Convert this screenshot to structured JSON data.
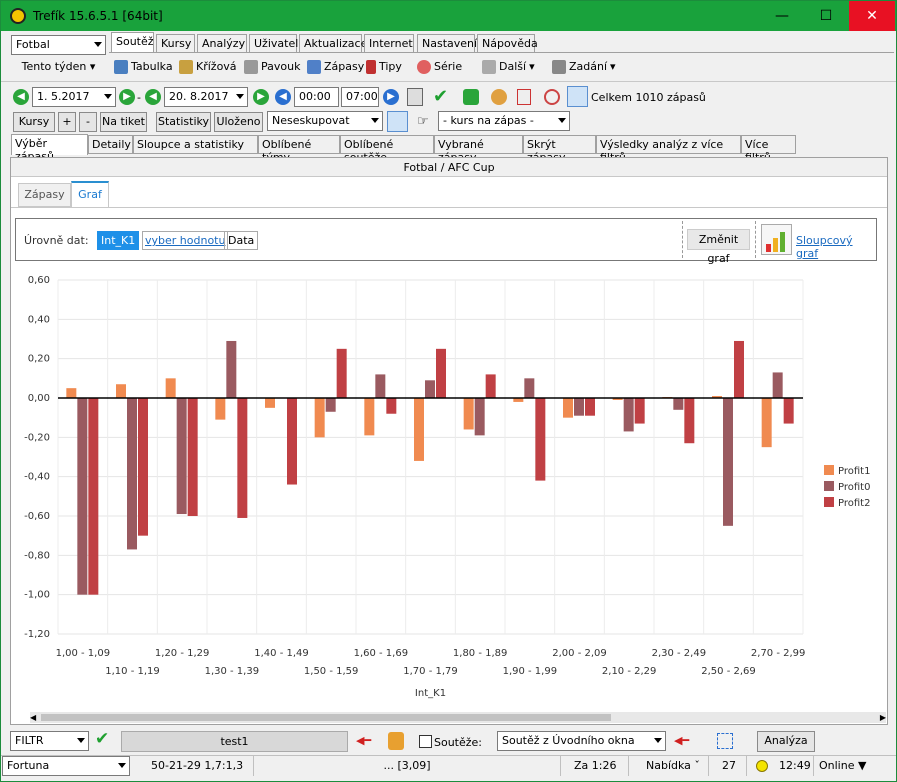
{
  "window": {
    "title": "Trefík 15.6.5.1 [64bit]",
    "min": "—",
    "max": "☐",
    "close": "✕"
  },
  "sport_select": {
    "value": "Fotbal"
  },
  "week_button": {
    "label": "Tento týden"
  },
  "main_tabs": [
    {
      "label": "Soutěž"
    },
    {
      "label": "Kursy"
    },
    {
      "label": "Analýzy"
    },
    {
      "label": "Uživatel"
    },
    {
      "label": "Aktualizace"
    },
    {
      "label": "Internet"
    },
    {
      "label": "Nastavení"
    },
    {
      "label": "Nápověda"
    }
  ],
  "toolbar": {
    "tabulka": "Tabulka",
    "krizova": "Křížová",
    "pavouk": "Pavouk",
    "zapasy": "Zápasy",
    "tipy": "Tipy",
    "serie": "Série",
    "dalsi": "Další",
    "zadani": "Zadání"
  },
  "dates": {
    "from": "1.  5.2017",
    "to": "20.  8.2017",
    "time_from": "00:00",
    "time_to": "07:00",
    "dash": "-"
  },
  "total_matches": "Celkem 1010 zápasů",
  "row3": {
    "kursy": "Kursy",
    "plus": "+",
    "minus": "-",
    "na_tiket": "Na tiket",
    "statistiky": "Statistiky",
    "ulozeno": "Uloženo",
    "group_select": "Neseskupovat",
    "kurs_select": "- kurs na zápas -"
  },
  "sub_tabs": [
    {
      "label": "Výběr zápasů"
    },
    {
      "label": "Detaily"
    },
    {
      "label": "Sloupce a statistiky"
    },
    {
      "label": "Oblíbené týmy"
    },
    {
      "label": "Oblíbené soutěže"
    },
    {
      "label": "Vybrané zápasy"
    },
    {
      "label": "Skrýt zápasy"
    },
    {
      "label": "Výsledky analýz z více filtrů"
    },
    {
      "label": "Více filtrů"
    }
  ],
  "competition_header": "Fotbal / AFC Cup",
  "inner_tabs": [
    {
      "label": "Zápasy"
    },
    {
      "label": "Graf"
    }
  ],
  "levels": {
    "label": "Úrovně dat:",
    "chip1": "Int_K1",
    "chip2": "vyber hodnotu",
    "chip3": "Data",
    "change_graph": "Změnit graf",
    "bar_graph_link": "Sloupcový graf"
  },
  "chart_data": {
    "type": "bar",
    "xlabel": "Int_K1",
    "ylim": [
      -1.2,
      0.6
    ],
    "yticks": [
      "0,60",
      "0,40",
      "0,20",
      "0,00",
      "-0,20",
      "-0,40",
      "-0,60",
      "-0,80",
      "-1,00",
      "-1,20"
    ],
    "categories": [
      "1,00 - 1,09",
      "1,10 - 1,19",
      "1,20 - 1,29",
      "1,30 - 1,39",
      "1,40 - 1,49",
      "1,50 - 1,59",
      "1,60 - 1,69",
      "1,70 - 1,79",
      "1,80 - 1,89",
      "1,90 - 1,99",
      "2,00 - 2,09",
      "2,10 - 2,29",
      "2,30 - 2,49",
      "2,50 - 2,69",
      "2,70 - 2,99"
    ],
    "series": [
      {
        "name": "Profit1",
        "color": "#f08a50",
        "values": [
          0.05,
          0.07,
          0.1,
          -0.11,
          -0.05,
          -0.2,
          -0.19,
          -0.32,
          -0.16,
          -0.02,
          -0.1,
          -0.01,
          0.005,
          0.01,
          -0.25
        ]
      },
      {
        "name": "Profit0",
        "color": "#9a5a60",
        "values": [
          -1.0,
          -0.77,
          -0.59,
          0.29,
          0.0,
          -0.07,
          0.12,
          0.09,
          -0.19,
          0.1,
          -0.09,
          -0.17,
          -0.06,
          -0.65,
          0.13
        ]
      },
      {
        "name": "Profit2",
        "color": "#c04044",
        "values": [
          -1.0,
          -0.7,
          -0.6,
          -0.61,
          -0.44,
          0.25,
          -0.08,
          0.25,
          0.12,
          -0.42,
          -0.09,
          -0.13,
          -0.23,
          0.29,
          -0.13
        ]
      }
    ],
    "legend": "right",
    "grid": true
  },
  "bottom": {
    "filter_select": "FILTR",
    "filter_name": "test1",
    "soutez_label": "Soutěže:",
    "soutez_select": "Soutěž z Úvodního okna",
    "analyza": "Analýza"
  },
  "status": {
    "bookmaker": "Fortuna",
    "record": "50-21-29  1,7:1,3",
    "dots": "... [3,09]",
    "za": "Za 1:26",
    "nabidka": "Nabídka ˇ",
    "count": "27",
    "time": "12:49",
    "online": "Online"
  }
}
